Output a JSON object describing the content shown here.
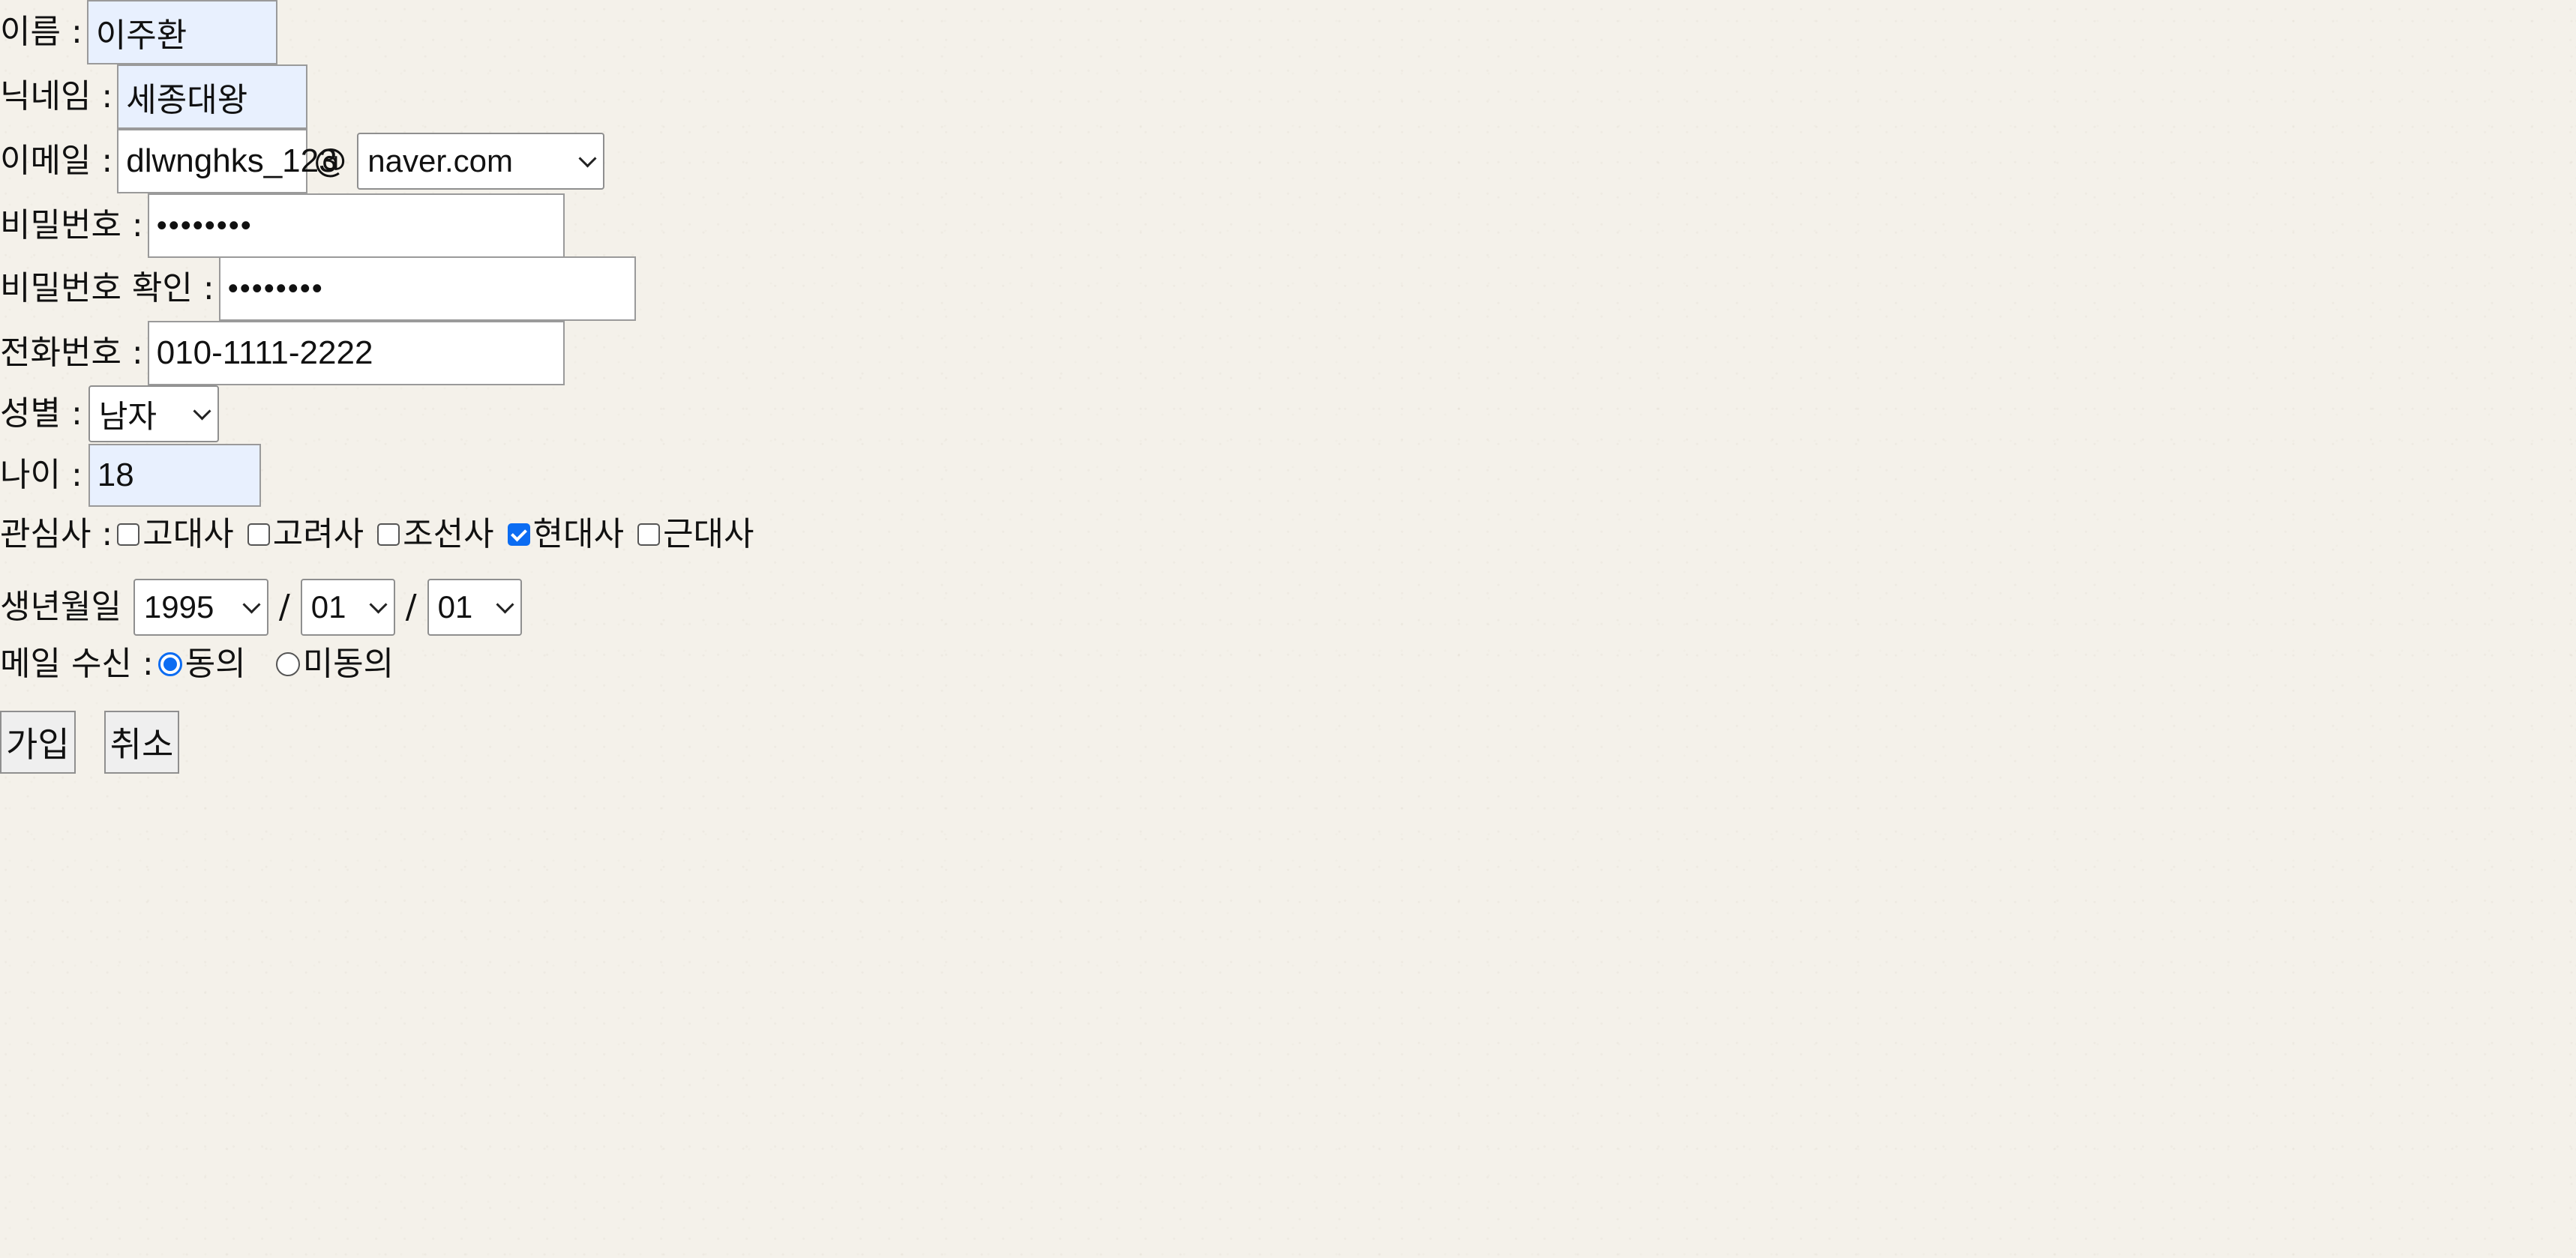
{
  "form": {
    "name": {
      "label": "이름 :",
      "value": "이주환"
    },
    "nickname": {
      "label": "닉네임 :",
      "value": "세종대왕"
    },
    "email": {
      "label": "이메일 :",
      "local": "dlwnghks_123",
      "at": "@",
      "domain": "naver.com"
    },
    "password": {
      "label": "비밀번호 :",
      "value": "••••••••"
    },
    "password_confirm": {
      "label": "비밀번호 확인 :",
      "value": "••••••••"
    },
    "phone": {
      "label": "전화번호 :",
      "value": "010-1111-2222"
    },
    "gender": {
      "label": "성별 :",
      "value": "남자"
    },
    "age": {
      "label": "나이 :",
      "value": "18"
    },
    "interests": {
      "label": "관심사 :",
      "options": [
        {
          "label": "고대사",
          "checked": false
        },
        {
          "label": "고려사",
          "checked": false
        },
        {
          "label": "조선사",
          "checked": false
        },
        {
          "label": "현대사",
          "checked": true
        },
        {
          "label": "근대사",
          "checked": false
        }
      ]
    },
    "birthdate": {
      "label": "생년월일",
      "year": "1995",
      "sep": "/",
      "month": "01",
      "day": "01"
    },
    "mail_consent": {
      "label": "메일 수신 :",
      "options": [
        {
          "label": "동의",
          "checked": true
        },
        {
          "label": "미동의",
          "checked": false
        }
      ]
    },
    "buttons": {
      "submit": "가입",
      "cancel": "취소"
    }
  },
  "colors": {
    "background": "#f4f1ea",
    "autofill": "#e8f0fe",
    "accent": "#0b6cf2"
  }
}
